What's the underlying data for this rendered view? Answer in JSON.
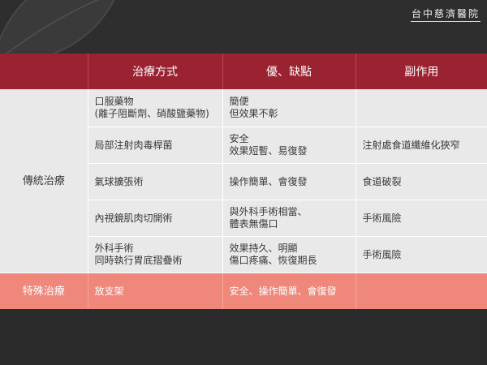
{
  "logo": {
    "text": "台中慈濟醫院"
  },
  "table": {
    "headers": [
      "",
      "治療方式",
      "優、缺點",
      "副作用"
    ],
    "traditional": {
      "category": "傳統治療",
      "rows": [
        {
          "method": [
            "口服藥物",
            "(離子阻斷劑、硝酸鹽藥物)"
          ],
          "pros_cons": [
            "簡便",
            "但效果不彰"
          ],
          "side_effect": ""
        },
        {
          "method": [
            "局部注射肉毒桿菌"
          ],
          "pros_cons": [
            "安全",
            "效果短暫、易復發"
          ],
          "side_effect": "注射處食道纖維化狹窄"
        },
        {
          "method": [
            "氣球擴張術"
          ],
          "pros_cons": [
            "操作簡單、會復發"
          ],
          "side_effect": "食道破裂"
        },
        {
          "method": [
            "內視鏡肌肉切開術"
          ],
          "pros_cons": [
            "與外科手術相當、",
            "體表無傷口"
          ],
          "side_effect": "手術風險"
        },
        {
          "method": [
            "外科手術",
            "同時執行胃底摺疊術"
          ],
          "pros_cons": [
            "效果持久、明顯",
            "傷口疼痛、恢復期長"
          ],
          "side_effect": "手術風險"
        }
      ]
    },
    "special": {
      "category": "特殊治療",
      "method": "放支架",
      "pros_cons": "安全、操作簡單、會復發",
      "side_effect": ""
    }
  }
}
